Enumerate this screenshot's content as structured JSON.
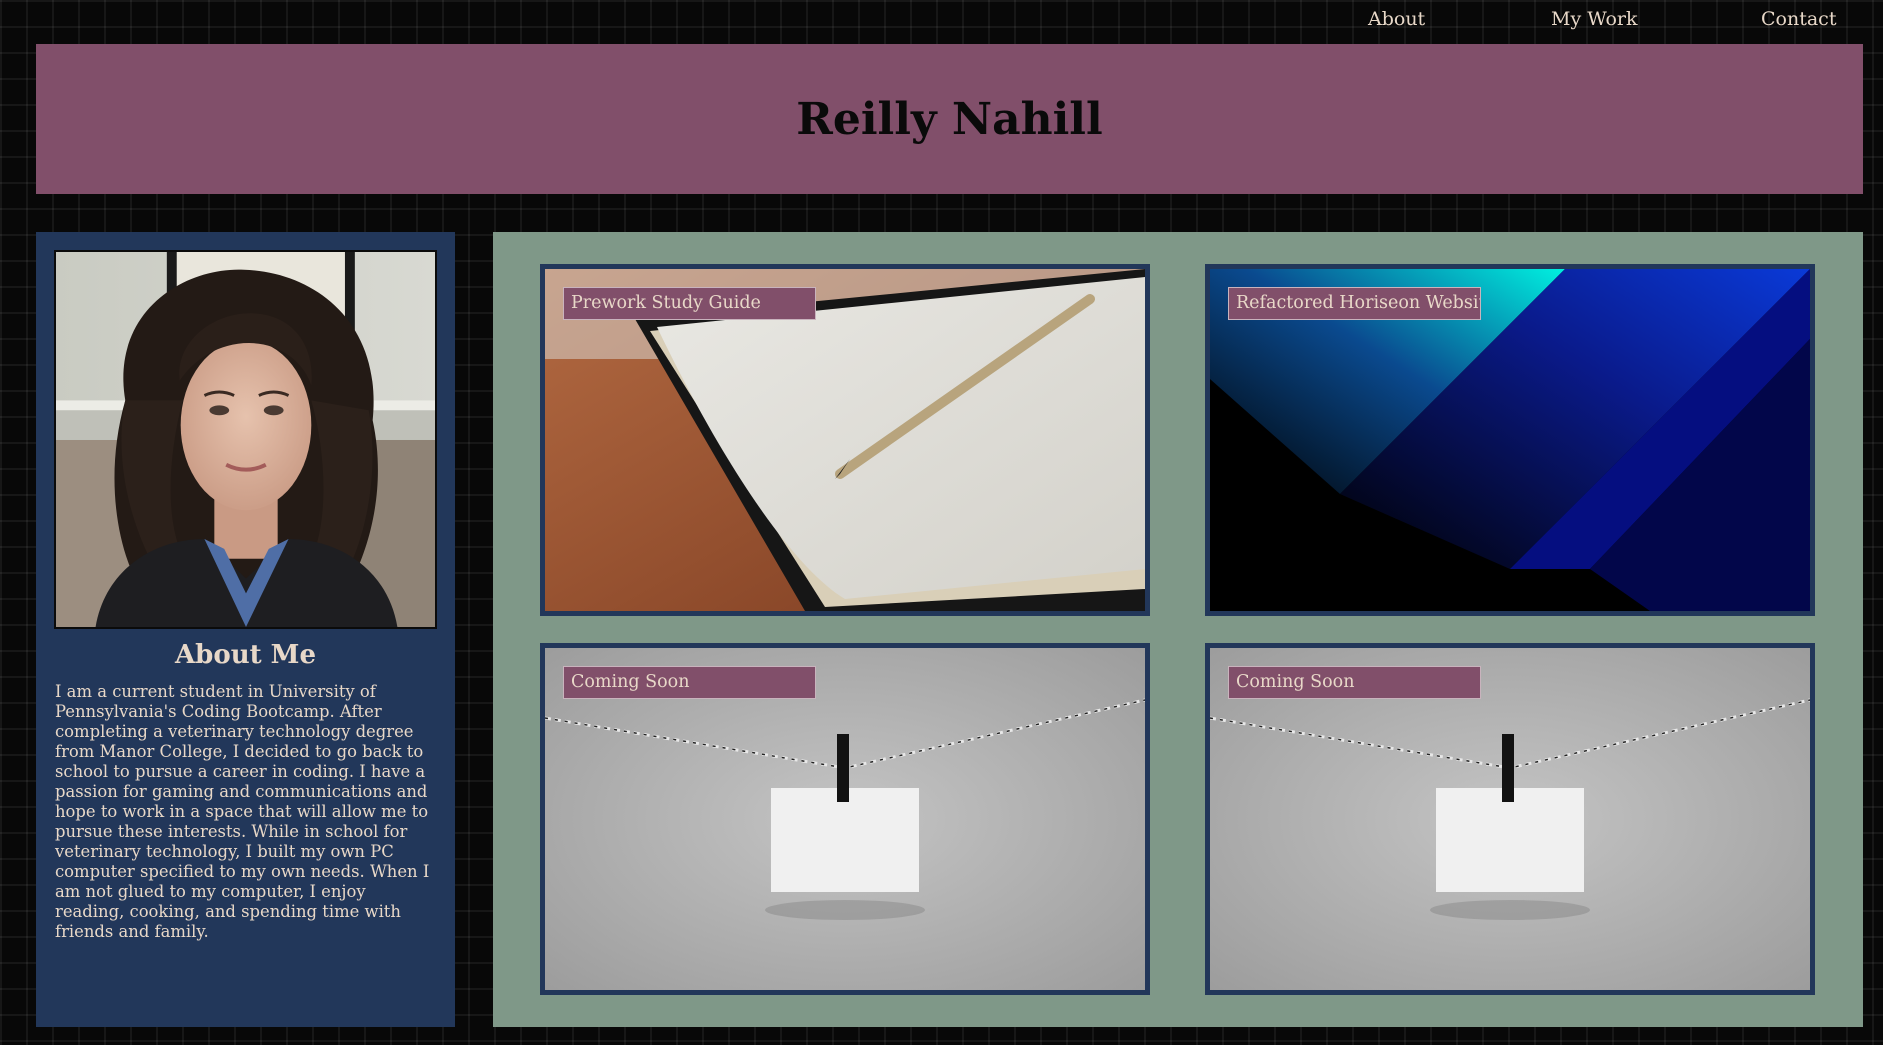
{
  "nav": {
    "about": "About",
    "my_work": "My Work",
    "contact": "Contact"
  },
  "header": {
    "title": "Reilly Nahill"
  },
  "about": {
    "heading": "About Me",
    "bio": "I am a current student in University of Pennsylvania's Coding Bootcamp. After completing a veterinary technology degree from Manor College, I decided to go back to school to pursue a career in coding. I have a passion for gaming and communications and hope to work in a space that will allow me to pursue these interests. While in school for veterinary technology, I built my own PC computer specified to my own needs. When I am not glued to my computer, I enjoy reading, cooking, and spending time with friends and family."
  },
  "work": {
    "projects": [
      {
        "label": "Prework Study Guide"
      },
      {
        "label": "Refactored Horiseon Website"
      },
      {
        "label": "Coming Soon"
      },
      {
        "label": "Coming Soon"
      }
    ]
  },
  "colors": {
    "header_bg": "#814f6a",
    "aside_bg": "#22375a",
    "work_bg": "#7f9888",
    "text": "#e8d8c8",
    "page_bg": "#080808"
  }
}
